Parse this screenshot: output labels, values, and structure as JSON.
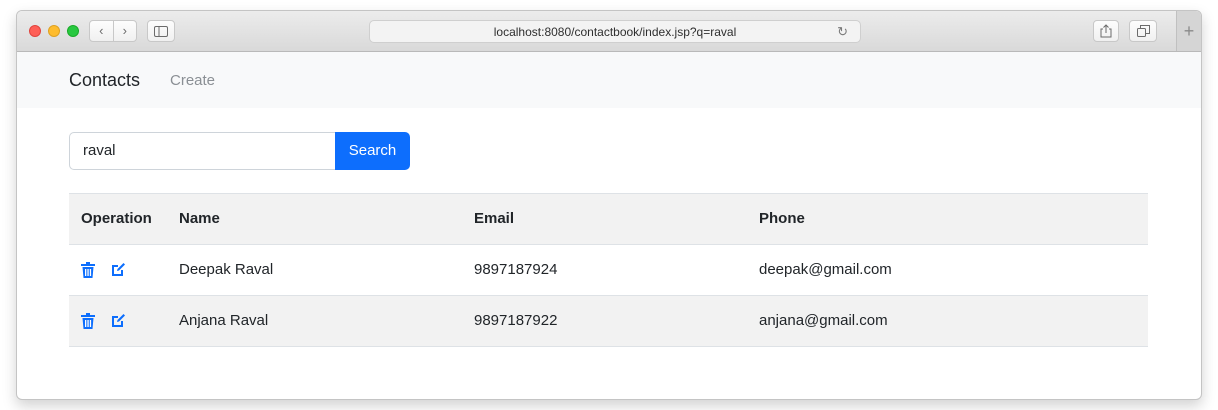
{
  "browser": {
    "url": "localhost:8080/contactbook/index.jsp?q=raval",
    "back_icon": "‹",
    "forward_icon": "›",
    "reload_icon": "↻",
    "new_tab_icon": "+"
  },
  "navbar": {
    "brand": "Contacts",
    "links": [
      "Create"
    ]
  },
  "search": {
    "value": "raval",
    "button_label": "Search"
  },
  "table": {
    "headers": [
      "Operation",
      "Name",
      "Email",
      "Phone"
    ],
    "rows": [
      {
        "name": "Deepak Raval",
        "email": "9897187924",
        "phone": "deepak@gmail.com"
      },
      {
        "name": "Anjana Raval",
        "email": "9897187922",
        "phone": "anjana@gmail.com"
      }
    ]
  },
  "colors": {
    "primary": "#0d6efd",
    "navbar_bg": "#f8f9fa",
    "stripe_bg": "#f2f2f2"
  }
}
